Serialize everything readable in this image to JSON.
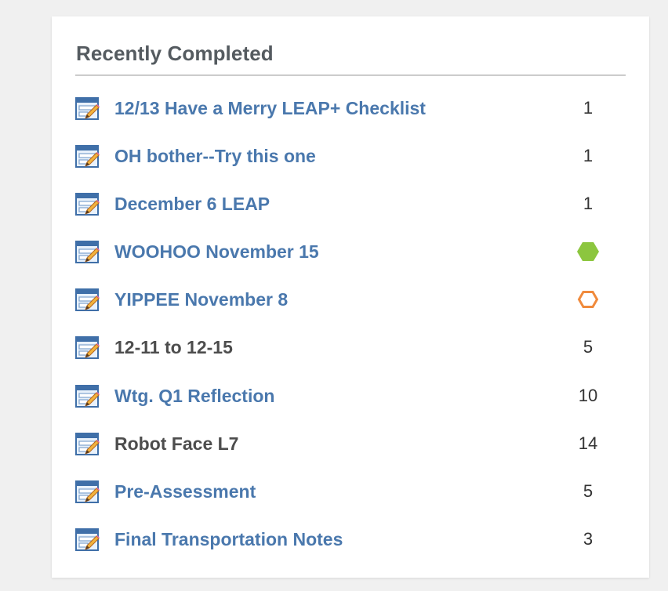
{
  "panel": {
    "title": "Recently Completed"
  },
  "items": [
    {
      "label": "12/13 Have a Merry LEAP+ Checklist",
      "count": "1",
      "is_link": true
    },
    {
      "label": "OH bother--Try this one",
      "count": "1",
      "is_link": true
    },
    {
      "label": "December 6 LEAP",
      "count": "1",
      "is_link": true
    },
    {
      "label": "WOOHOO November 15",
      "status": "filled-hexagon",
      "status_color": "#8cc63f",
      "is_link": true
    },
    {
      "label": "YIPPEE November 8",
      "status": "outline-hexagon",
      "status_color": "#f08a3c",
      "is_link": true
    },
    {
      "label": "12-11 to 12-15",
      "count": "5",
      "is_link": false
    },
    {
      "label": "Wtg. Q1 Reflection",
      "count": "10",
      "is_link": true
    },
    {
      "label": "Robot Face L7",
      "count": "14",
      "is_link": false
    },
    {
      "label": "Pre-Assessment",
      "count": "5",
      "is_link": true
    },
    {
      "label": "Final Transportation Notes",
      "count": "3",
      "is_link": true
    }
  ],
  "icons": {
    "item_icon": "form-edit-icon"
  },
  "colors": {
    "link": "#4a78ad",
    "plain_text": "#4d4d4d",
    "title": "#555b60"
  }
}
